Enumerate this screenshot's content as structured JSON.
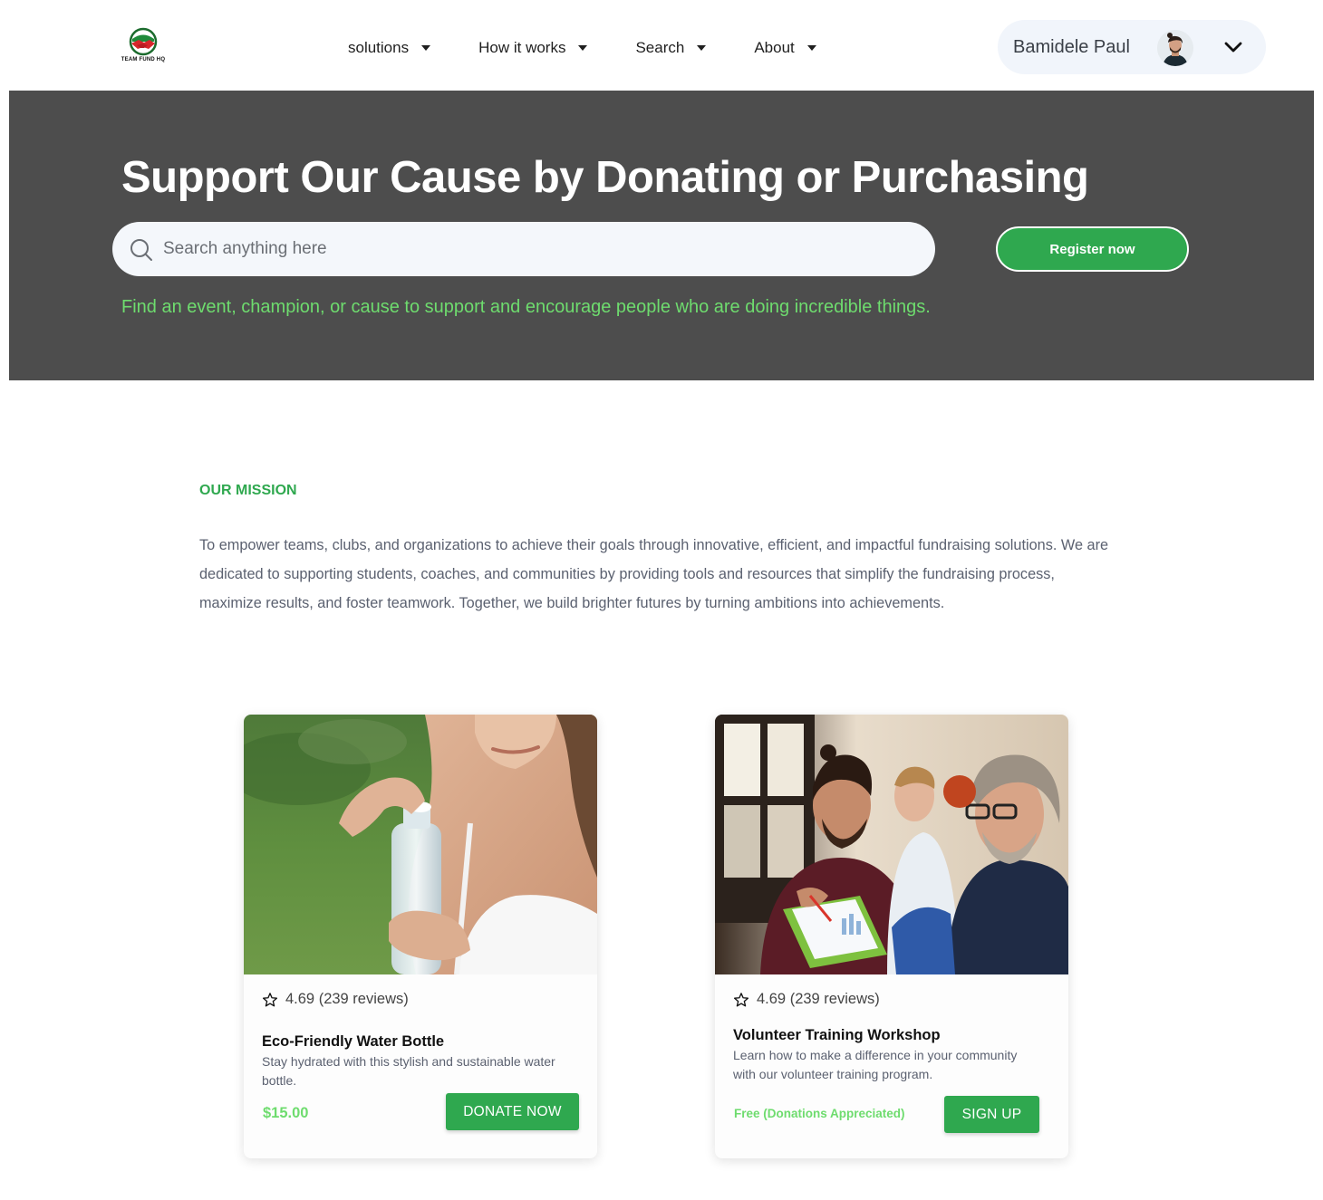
{
  "header": {
    "logo_text": "TEAM FUND HQ",
    "nav": [
      {
        "label": "solutions"
      },
      {
        "label": "How it works"
      },
      {
        "label": "Search"
      },
      {
        "label": "About"
      }
    ],
    "user": {
      "name": "Bamidele Paul"
    }
  },
  "hero": {
    "title": "Support Our Cause by Donating or Purchasing",
    "search_placeholder": "Search anything here",
    "register_label": "Register now",
    "subtitle": "Find an event, champion, or cause to support and encourage people who are doing incredible things."
  },
  "mission": {
    "label": "OUR MISSION",
    "text": "To empower teams, clubs, and organizations to achieve their goals through innovative, efficient, and impactful fundraising solutions. We are dedicated to supporting students, coaches, and communities by providing tools and resources that simplify the fundraising process, maximize results, and foster teamwork. Together, we build brighter futures by turning ambitions into achievements."
  },
  "cards": [
    {
      "rating": "4.69 (239 reviews)",
      "title": "Eco-Friendly Water Bottle",
      "description": "Stay hydrated with this stylish and sustainable water bottle.",
      "price": "$15.00",
      "button": "DONATE NOW"
    },
    {
      "rating": "4.69 (239 reviews)",
      "title": "Volunteer Training Workshop",
      "description": "Learn how to make a difference in your community with our volunteer training program.",
      "price": "Free (Donations Appreciated)",
      "button": "SIGN UP"
    }
  ],
  "colors": {
    "brand_green": "#2fa84f",
    "accent_green": "#6edc6e",
    "hero_bg": "#4d4d4d"
  }
}
